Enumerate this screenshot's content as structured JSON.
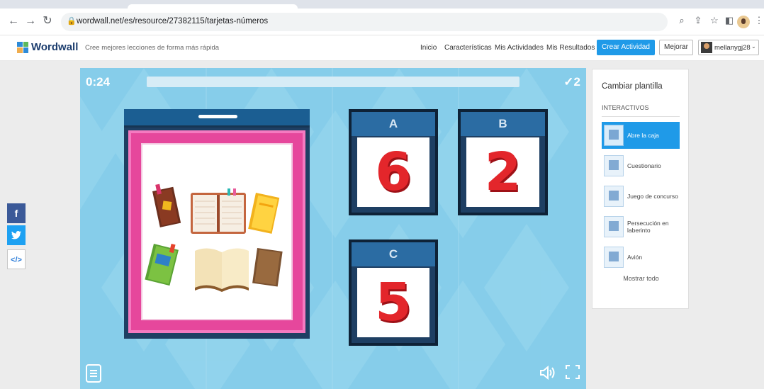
{
  "browser": {
    "url": "wordwall.net/es/resource/27382115/tarjetas-números"
  },
  "header": {
    "brand": "Wordwall",
    "tagline": "Cree mejores lecciones de forma más rápida",
    "nav": [
      "Inicio",
      "Características",
      "Mis Actividades",
      "Mis Resultados"
    ],
    "create_label": "Crear Actividad",
    "improve_label": "Mejorar",
    "username": "mellanygj28"
  },
  "share": {
    "facebook": "f",
    "twitter": "t",
    "embed": "</>"
  },
  "game": {
    "timer": "0:24",
    "score": "✓2",
    "cards": [
      {
        "letter": "A",
        "number": "6"
      },
      {
        "letter": "B",
        "number": "2"
      },
      {
        "letter": "C",
        "number": "5"
      }
    ]
  },
  "panel": {
    "title": "Cambiar plantilla",
    "subtitle": "INTERACTIVOS",
    "templates": [
      {
        "label": "Abre la caja",
        "active": true
      },
      {
        "label": "Cuestionario",
        "active": false
      },
      {
        "label": "Juego de concurso",
        "active": false
      },
      {
        "label": "Persecución en laberinto",
        "active": false
      },
      {
        "label": "Avión",
        "active": false
      }
    ],
    "show_all": "Mostrar todo"
  },
  "colors": {
    "accent": "#1f9ae8",
    "game_bg": "#86cdea",
    "box_frame": "#e6479c",
    "number_red": "#e3262b"
  }
}
